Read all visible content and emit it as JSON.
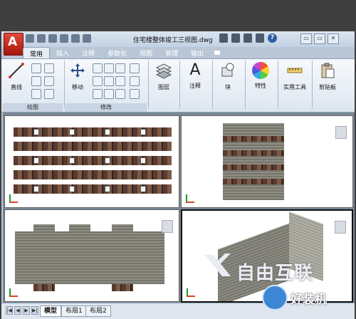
{
  "title_bar": {
    "document_title": "住宅楼整体竣工三视图.dwg",
    "app_button_letter": "A",
    "window_controls": [
      "▭",
      "▭",
      "✕"
    ]
  },
  "ribbon_tabs": [
    "常用",
    "插入",
    "注释",
    "参数化",
    "视图",
    "管理",
    "输出"
  ],
  "active_tab": "常用",
  "ribbon": {
    "draw_panel": {
      "title": "绘图",
      "line_label": "直线"
    },
    "modify_panel": {
      "title": "修改",
      "move_label": "移动"
    },
    "layers_label": "图层",
    "annotation_label": "注释",
    "block_label": "块",
    "properties_label": "特性",
    "utilities_label": "实用工具",
    "clipboard_label": "剪贴板"
  },
  "layout_tabs": [
    "模型",
    "布局1",
    "布局2"
  ],
  "active_layout": "模型",
  "nav_arrows": [
    "|◀",
    "◀",
    "▶",
    "▶|"
  ],
  "watermarks": {
    "brand_text": "自由互联",
    "brand2_text": "好装机"
  }
}
